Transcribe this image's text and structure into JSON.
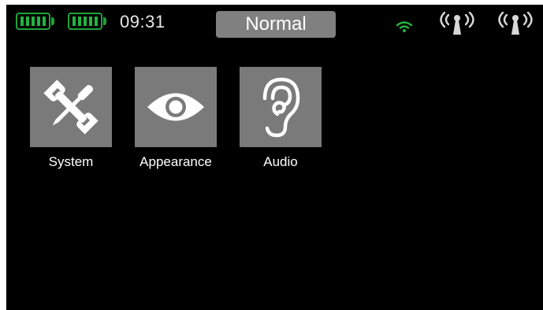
{
  "status_bar": {
    "battery_icons": [
      "battery-icon",
      "battery-icon"
    ],
    "battery_level": 1.0,
    "time": "09:31",
    "mode": "Normal",
    "wifi_icon": "wifi-icon",
    "antenna_icons": [
      "antenna-icon",
      "antenna-icon"
    ]
  },
  "apps": [
    {
      "label": "System",
      "icon": "wrench-screwdriver-icon"
    },
    {
      "label": "Appearance",
      "icon": "eye-icon"
    },
    {
      "label": "Audio",
      "icon": "ear-icon"
    }
  ],
  "colors": {
    "background": "#000000",
    "tile": "#7a7a7a",
    "badge": "#808080",
    "battery": "#22b43f",
    "text": "#ffffff"
  }
}
